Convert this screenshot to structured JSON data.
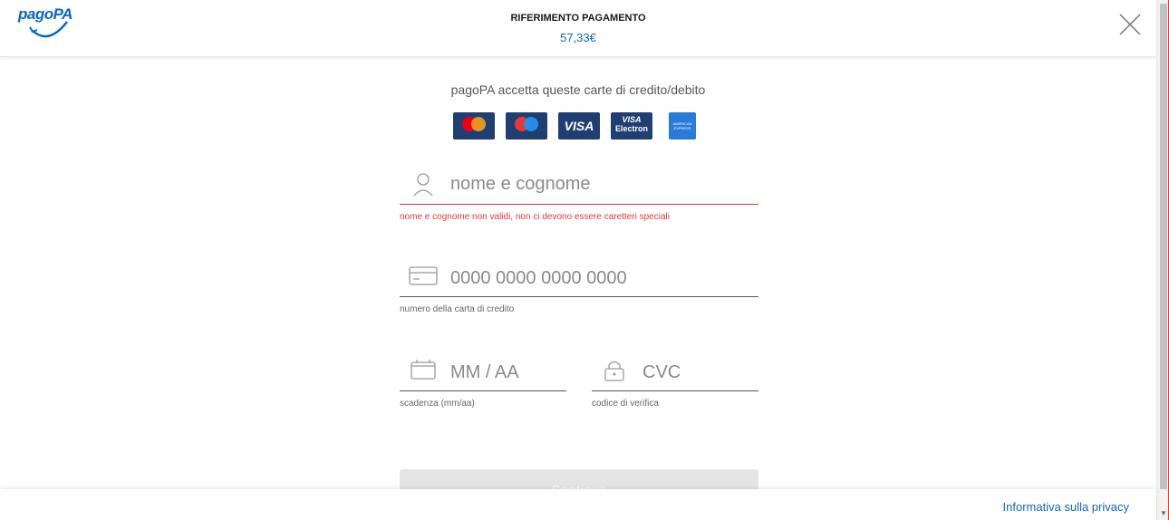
{
  "header": {
    "logo_text": "pagoPA",
    "reference_title": "RIFERIMENTO PAGAMENTO",
    "amount": "57,33€"
  },
  "cards_section": {
    "accept_text": "pagoPA accetta queste carte di credito/debito",
    "cards": [
      {
        "name": "mastercard",
        "label": "mastercard"
      },
      {
        "name": "maestro",
        "label": "maestro"
      },
      {
        "name": "visa",
        "label": "VISA"
      },
      {
        "name": "visa-electron",
        "label_top": "VISA",
        "label_bottom": "Electron"
      },
      {
        "name": "american-express",
        "label": "AMERICAN EXPRESS"
      }
    ]
  },
  "form": {
    "name_field": {
      "placeholder": "nome e cognome",
      "error": "nome e cognome non validi, non ci devono essere caretteri speciali"
    },
    "card_number_field": {
      "placeholder": "0000 0000 0000 0000",
      "helper": "numero della carta di credito"
    },
    "expiry_field": {
      "placeholder": "MM / AA",
      "helper": "scadenza (mm/aa)"
    },
    "cvc_field": {
      "placeholder": "CVC",
      "helper": "codice di verifica"
    },
    "continue_label": "Continua"
  },
  "footer": {
    "privacy_label": "Informativa sulla privacy"
  },
  "colors": {
    "accent": "#1565c0",
    "error": "#e53935",
    "card_bg": "#1f3f73"
  }
}
